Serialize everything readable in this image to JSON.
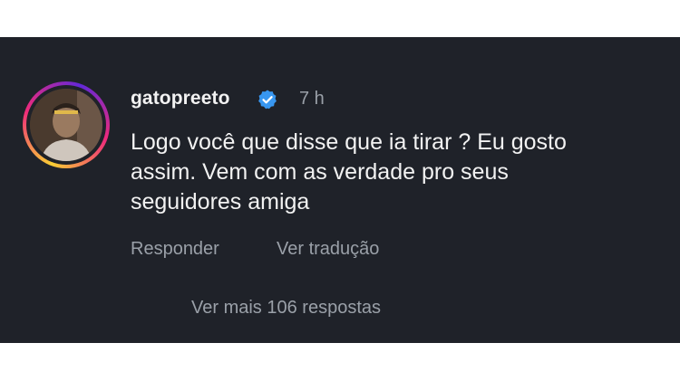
{
  "comment": {
    "username": "gatopreeto",
    "verified": true,
    "time": "7 h",
    "lines": [
      "Logo você que disse que ia tirar ? Eu gosto",
      "assim. Vem com as verdade pro seus",
      "seguidores amiga"
    ],
    "actions": {
      "reply_label": "Responder",
      "translate_label": "Ver tradução"
    },
    "more_replies_label": "Ver mais 106 respostas"
  },
  "colors": {
    "background": "#1f2229",
    "text": "#f2f2f2",
    "muted": "#9aa0a8",
    "verified_badge": "#3897f0"
  },
  "icons": {
    "avatar": "profile-photo",
    "badge": "verified-badge-icon"
  }
}
